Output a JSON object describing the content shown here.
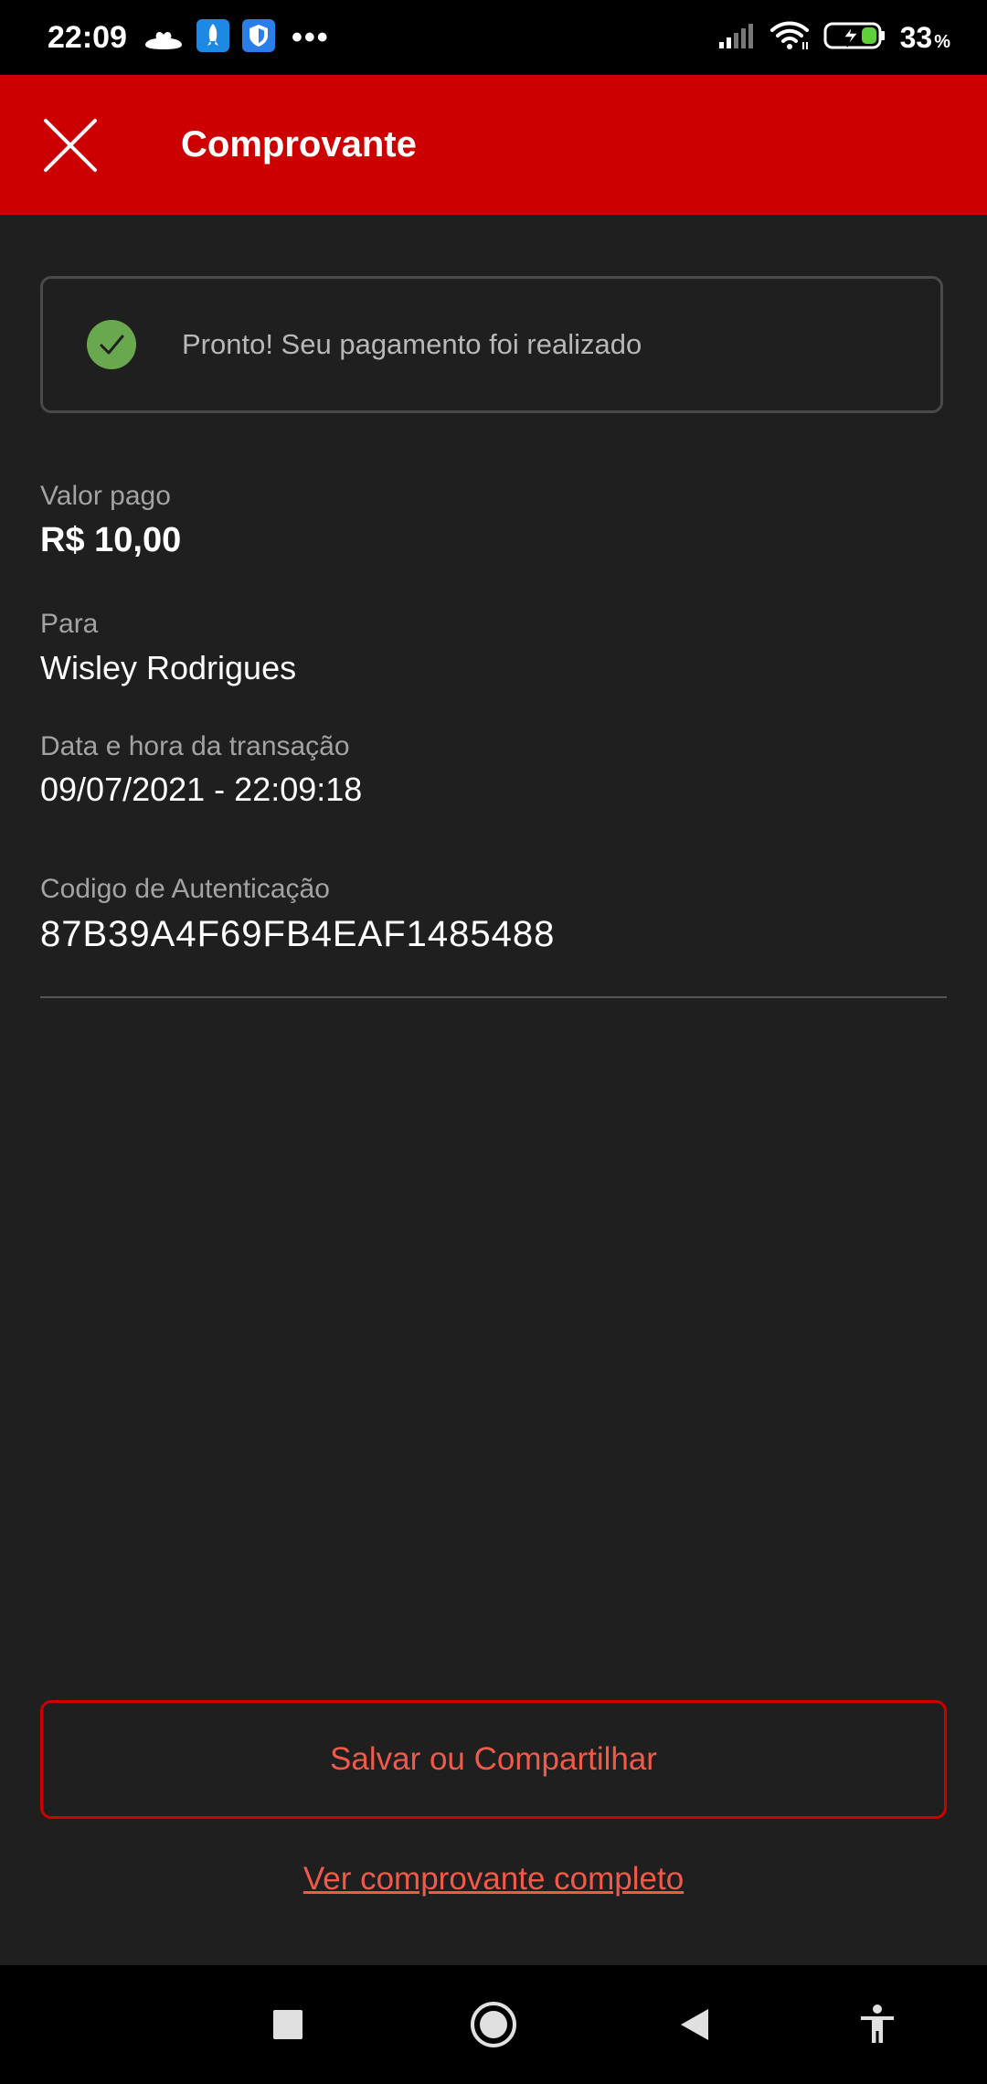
{
  "status_bar": {
    "time": "22:09",
    "battery_percent": "33",
    "battery_unit": "%",
    "icons": [
      "santander-logo-icon",
      "rocket-app-icon",
      "shield-app-icon",
      "more-notifications-icon",
      "signal-icon",
      "wifi-icon",
      "battery-charging-icon"
    ]
  },
  "header": {
    "title": "Comprovante",
    "close_icon": "close-icon"
  },
  "success": {
    "message": "Pronto! Seu pagamento foi realizado",
    "icon": "check-circle-icon",
    "icon_color": "#6aa84f"
  },
  "details": {
    "amount_label": "Valor pago",
    "amount_value": "R$ 10,00",
    "recipient_label": "Para",
    "recipient_value": "Wisley Rodrigues",
    "datetime_label": "Data e hora da transação",
    "datetime_value": "09/07/2021 - 22:09:18",
    "auth_label": "Codigo de Autenticação",
    "auth_value": "87B39A4F69FB4EAF1485488"
  },
  "actions": {
    "save_label": "Salvar ou Compartilhar",
    "full_receipt_label": "Ver comprovante completo"
  },
  "nav_bar": {
    "items": [
      "recents-square-icon",
      "home-circle-icon",
      "back-triangle-icon",
      "accessibility-icon"
    ]
  },
  "colors": {
    "brand_red": "#cc0000",
    "accent_text": "#f05a48",
    "background": "#1f1f1f"
  }
}
